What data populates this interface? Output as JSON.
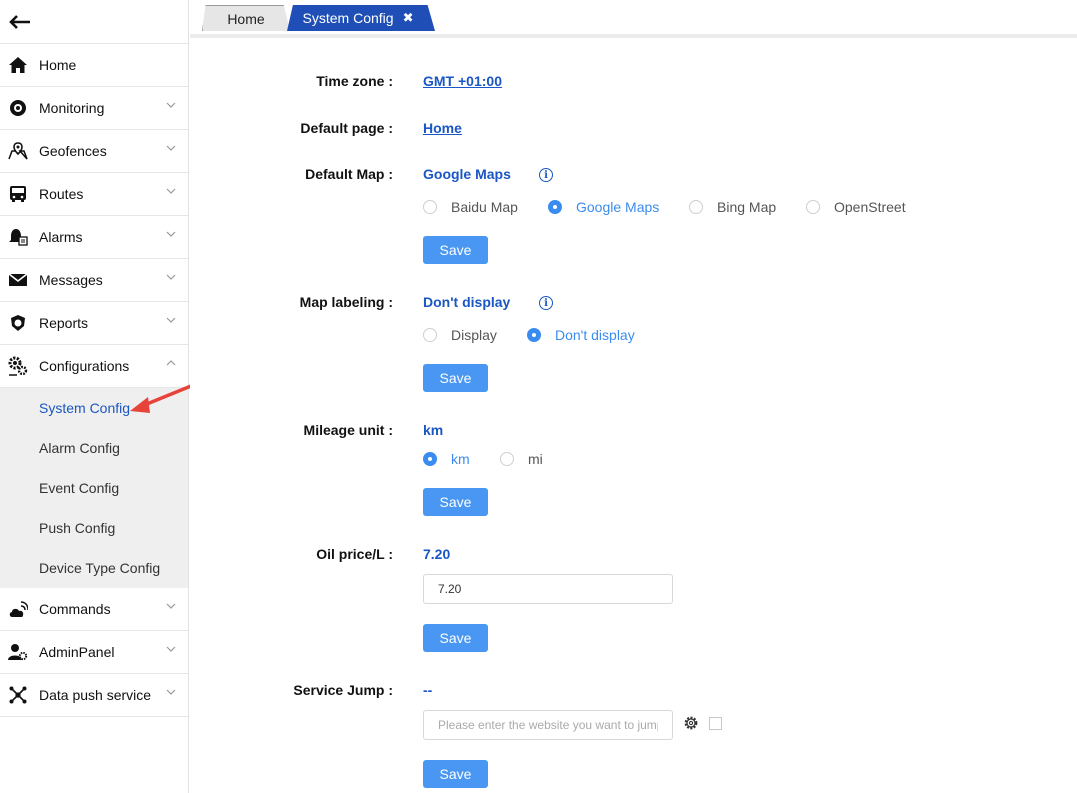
{
  "sidebar": {
    "back_icon": "arrow-left-icon",
    "items": [
      {
        "label": "Home",
        "icon": "home-icon"
      },
      {
        "label": "Monitoring",
        "icon": "monitoring-icon"
      },
      {
        "label": "Geofences",
        "icon": "map-pin-icon"
      },
      {
        "label": "Routes",
        "icon": "bus-icon"
      },
      {
        "label": "Alarms",
        "icon": "bell-icon"
      },
      {
        "label": "Messages",
        "icon": "envelope-icon"
      },
      {
        "label": "Reports",
        "icon": "shield-icon"
      },
      {
        "label": "Configurations",
        "icon": "gears-icon"
      }
    ],
    "sub_items": [
      "System Config",
      "Alarm Config",
      "Event Config",
      "Push Config",
      "Device Type Config"
    ],
    "items_after": [
      {
        "label": "Commands",
        "icon": "cloud-signal-icon"
      },
      {
        "label": "AdminPanel",
        "icon": "user-gear-icon"
      },
      {
        "label": "Data push service",
        "icon": "network-icon"
      }
    ]
  },
  "tabs": {
    "home": "Home",
    "active": "System Config",
    "close_glyph": "✖"
  },
  "config": {
    "timezone": {
      "label": "Time zone :",
      "value": "GMT +01:00"
    },
    "default_page": {
      "label": "Default page :",
      "value": "Home"
    },
    "default_map": {
      "label": "Default Map :",
      "value": "Google Maps",
      "options": [
        "Baidu Map",
        "Google Maps",
        "Bing Map",
        "OpenStreet"
      ],
      "selected": "Google Maps",
      "save": "Save"
    },
    "map_labeling": {
      "label": "Map labeling :",
      "value": "Don't display",
      "options": [
        "Display",
        "Don't display"
      ],
      "selected": "Don't display",
      "save": "Save"
    },
    "mileage_unit": {
      "label": "Mileage unit :",
      "value": "km",
      "options": [
        "km",
        "mi"
      ],
      "selected": "km",
      "save": "Save"
    },
    "oil_price": {
      "label": "Oil price/L :",
      "value": "7.20",
      "input_value": "7.20",
      "save": "Save"
    },
    "service_jump": {
      "label": "Service Jump :",
      "value": "--",
      "placeholder": "Please enter the website you want to jump to",
      "save": "Save"
    },
    "info_glyph": "i"
  },
  "colors": {
    "accent": "#1a56c4",
    "button": "#4a97f3",
    "radio_on": "#3b8cf0",
    "active_tab": "#1f4fb6",
    "annotation_arrow": "#e8433a"
  }
}
